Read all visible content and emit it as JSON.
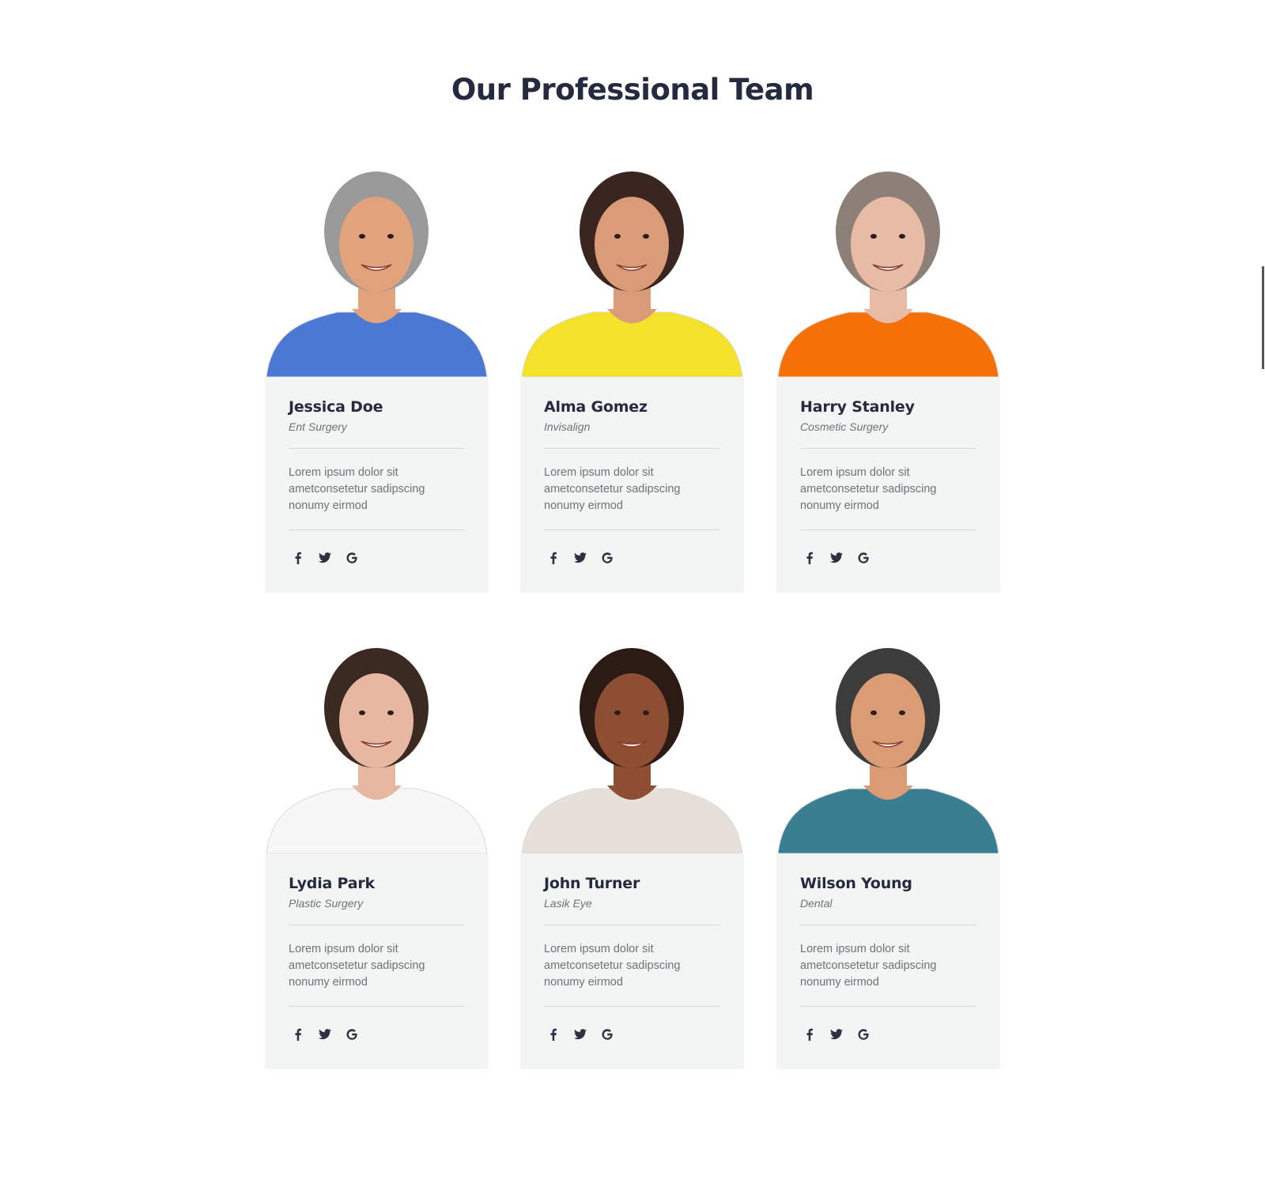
{
  "section": {
    "title": "Our Professional Team"
  },
  "social_icons": [
    "facebook-icon",
    "twitter-icon",
    "google-icon"
  ],
  "members": [
    {
      "name": "Jessica Doe",
      "role": "Ent Surgery",
      "description": "Lorem ipsum dolor sit ametconsetetur sadipscing nonumy eirmod",
      "shirt_color": "#4a78d2",
      "hair_color": "#9a9a9a",
      "skin_color": "#e2a27c"
    },
    {
      "name": "Alma Gomez",
      "role": "Invisalign",
      "description": "Lorem ipsum dolor sit ametconsetetur sadipscing nonumy eirmod",
      "shirt_color": "#f4e22a",
      "hair_color": "#3a2620",
      "skin_color": "#d99b78"
    },
    {
      "name": "Harry Stanley",
      "role": "Cosmetic Surgery",
      "description": "Lorem ipsum dolor sit ametconsetetur sadipscing nonumy eirmod",
      "shirt_color": "#f57108",
      "hair_color": "#8c8078",
      "skin_color": "#e7bba5"
    },
    {
      "name": "Lydia Park",
      "role": "Plastic Surgery",
      "description": "Lorem ipsum dolor sit ametconsetetur sadipscing nonumy eirmod",
      "shirt_color": "#f7f7f7",
      "hair_color": "#3a2a22",
      "skin_color": "#e7b7a2"
    },
    {
      "name": "John Turner",
      "role": "Lasik Eye",
      "description": "Lorem ipsum dolor sit ametconsetetur sadipscing nonumy eirmod",
      "shirt_color": "#e6e0d8",
      "hair_color": "#2c1a14",
      "skin_color": "#8e4e34"
    },
    {
      "name": "Wilson Young",
      "role": "Dental",
      "description": "Lorem ipsum dolor sit ametconsetetur sadipscing nonumy eirmod",
      "shirt_color": "#3a7e92",
      "hair_color": "#3c3c3c",
      "skin_color": "#d99c74"
    }
  ]
}
